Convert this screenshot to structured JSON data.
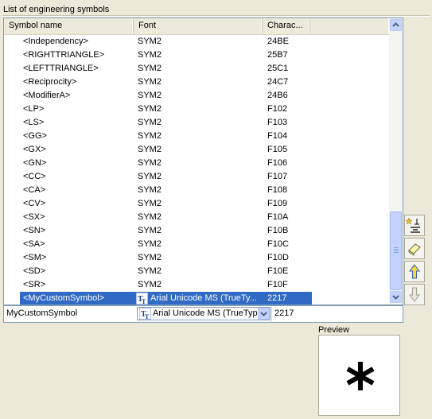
{
  "section_title": "List of engineering symbols",
  "columns": [
    "Symbol name",
    "Font",
    "Charac..."
  ],
  "rows": [
    {
      "name": "<Independency>",
      "font": "SYM2",
      "code": "24BE"
    },
    {
      "name": "<RIGHTTRIANGLE>",
      "font": "SYM2",
      "code": "25B7"
    },
    {
      "name": "<LEFTTRIANGLE>",
      "font": "SYM2",
      "code": "25C1"
    },
    {
      "name": "<Reciprocity>",
      "font": "SYM2",
      "code": "24C7"
    },
    {
      "name": "<ModifierA>",
      "font": "SYM2",
      "code": "24B6"
    },
    {
      "name": "<LP>",
      "font": "SYM2",
      "code": "F102"
    },
    {
      "name": "<LS>",
      "font": "SYM2",
      "code": "F103"
    },
    {
      "name": "<GG>",
      "font": "SYM2",
      "code": "F104"
    },
    {
      "name": "<GX>",
      "font": "SYM2",
      "code": "F105"
    },
    {
      "name": "<GN>",
      "font": "SYM2",
      "code": "F106"
    },
    {
      "name": "<CC>",
      "font": "SYM2",
      "code": "F107"
    },
    {
      "name": "<CA>",
      "font": "SYM2",
      "code": "F108"
    },
    {
      "name": "<CV>",
      "font": "SYM2",
      "code": "F109"
    },
    {
      "name": "<SX>",
      "font": "SYM2",
      "code": "F10A"
    },
    {
      "name": "<SN>",
      "font": "SYM2",
      "code": "F10B"
    },
    {
      "name": "<SA>",
      "font": "SYM2",
      "code": "F10C"
    },
    {
      "name": "<SM>",
      "font": "SYM2",
      "code": "F10D"
    },
    {
      "name": "<SD>",
      "font": "SYM2",
      "code": "F10E"
    },
    {
      "name": "<SR>",
      "font": "SYM2",
      "code": "F10F"
    }
  ],
  "selected_row": {
    "name": "<MyCustomSymbol>",
    "font": "Arial Unicode MS (TrueTy...",
    "code": "2217"
  },
  "editor": {
    "name_value": "MyCustomSymbol",
    "font_value": "Arial Unicode MS (TrueType)",
    "code_value": "2217"
  },
  "preview": {
    "label": "Preview",
    "glyph": "*"
  },
  "icons": {
    "font_type": "truetype-icon",
    "tools": [
      "new-symbol-icon",
      "eraser-icon",
      "arrow-up-icon",
      "arrow-down-icon"
    ]
  },
  "colors": {
    "selection": "#316ac5",
    "border": "#7f9db9",
    "background": "#ece9d8"
  }
}
